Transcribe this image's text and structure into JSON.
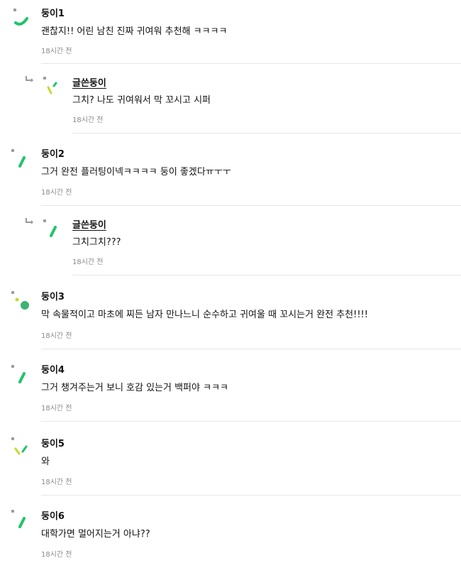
{
  "comments": [
    {
      "id": "c1",
      "author": "둥이1",
      "text": "괜찮지!! 어린 남친 진짜 귀여워 추천해 ㅋㅋㅋㅋ",
      "time": "18시간 전"
    },
    {
      "id": "r1",
      "author": "글쓴둥이",
      "text": "그치? 나도 귀여워서 막 꼬시고 시퍼",
      "time": "18시간 전",
      "reply": true
    },
    {
      "id": "c2",
      "author": "둥이2",
      "text": "그거 완전 플러팅이넥ㅋㅋㅋㅋ 둥이 좋겠다ㅠㅜㅜ",
      "time": "18시간 전"
    },
    {
      "id": "r2",
      "author": "글쓴둥이",
      "text": "그치그치???",
      "time": "18시간 전",
      "reply": true
    },
    {
      "id": "c3",
      "author": "둥이3",
      "text": "막 속물적이고 마초에 찌든 남자 만나느니 순수하고 귀여울 때 꼬시는거 완전 추천!!!!",
      "time": "18시간 전"
    },
    {
      "id": "c4",
      "author": "둥이4",
      "text": "그거 챙겨주는거 보니 호감 있는거 백퍼야 ㅋㅋㅋ",
      "time": "18시간 전"
    },
    {
      "id": "c5",
      "author": "둥이5",
      "text": "와",
      "time": "18시간 전"
    },
    {
      "id": "c6",
      "author": "둥이6",
      "text": "대학가면 멀어지는거 아냐??",
      "time": "18시간 전"
    }
  ],
  "colors": {
    "accent_green": "#21c36b",
    "accent_lime": "#c6d82f",
    "gray_dot": "#9a9a9a"
  },
  "icons": {
    "reply": "reply-arrow-icon",
    "avatar": "avatar-icon"
  }
}
